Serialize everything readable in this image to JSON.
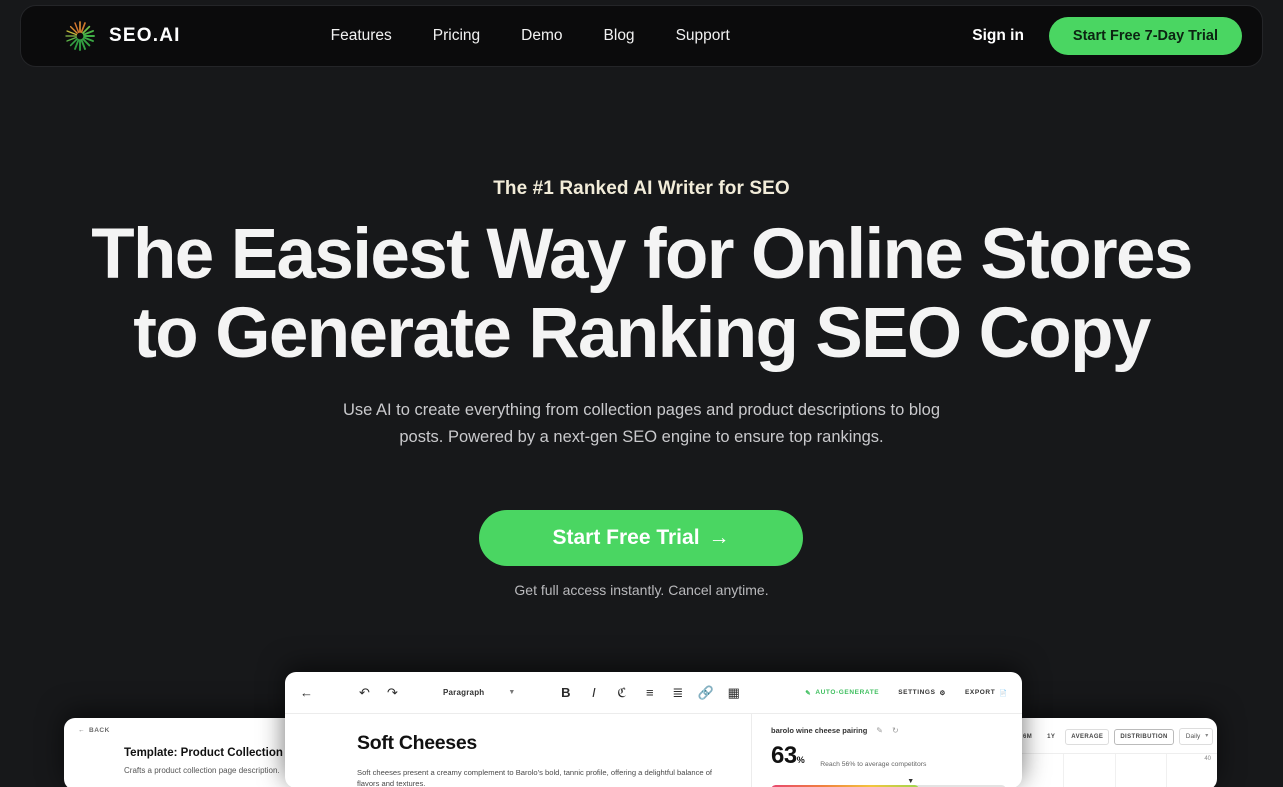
{
  "brand": {
    "name": "SEO.AI",
    "logo_icon": "sunburst-logo-icon"
  },
  "nav": {
    "links": [
      {
        "label": "Features"
      },
      {
        "label": "Pricing"
      },
      {
        "label": "Demo"
      },
      {
        "label": "Blog"
      },
      {
        "label": "Support"
      }
    ],
    "signin_label": "Sign in",
    "cta_label": "Start Free 7-Day Trial"
  },
  "hero": {
    "eyebrow": "The #1 Ranked AI Writer for SEO",
    "headline_line1": "The Easiest Way for Online Stores",
    "headline_line2": "to Generate Ranking SEO Copy",
    "subtitle_line1": "Use AI to create everything from collection pages and product descriptions to blog",
    "subtitle_line2": "posts. Powered by a next-gen SEO engine to ensure top rankings.",
    "cta_label": "Start Free Trial",
    "cta_arrow": "→",
    "cta_subtext": "Get full access instantly. Cancel anytime."
  },
  "preview": {
    "left_panel": {
      "back_label": "BACK",
      "back_icon": "arrow-left-icon",
      "title": "Template: Product Collection Desc",
      "description": "Crafts a product collection page description."
    },
    "editor": {
      "toolbar": {
        "back_icon": "arrow-left-icon",
        "undo_icon": "undo-icon",
        "redo_icon": "redo-icon",
        "block_style": "Paragraph",
        "chevron_icon": "chevron-down-icon",
        "bold_icon": "bold-icon",
        "italic_icon": "italic-icon",
        "highlight_icon": "highlight-icon",
        "bullet_list_icon": "bullet-list-icon",
        "numbered_list_icon": "numbered-list-icon",
        "link_icon": "link-icon",
        "table_icon": "table-icon",
        "auto_generate_label": "AUTO-GENERATE",
        "auto_generate_icon": "pencil-icon",
        "settings_label": "SETTINGS",
        "settings_icon": "gear-icon",
        "export_label": "EXPORT",
        "export_icon": "document-icon"
      },
      "document": {
        "heading": "Soft Cheeses",
        "paragraph": "Soft cheeses present a creamy complement to Barolo's bold, tannic profile, offering a delightful balance of flavors and textures."
      },
      "score_panel": {
        "keyword": "barolo wine cheese pairing",
        "edit_icon": "pencil-icon",
        "refresh_icon": "refresh-icon",
        "score": "63",
        "score_unit": "%",
        "note": "Reach 56% to average competitors",
        "marker_icon": "triangle-down-icon"
      }
    },
    "right_panel": {
      "tabs": [
        {
          "label": "6M"
        },
        {
          "label": "1Y"
        },
        {
          "label": "AVERAGE"
        },
        {
          "label": "DISTRIBUTION"
        }
      ],
      "interval": "Daily",
      "chart_axis_label": "40"
    }
  },
  "colors": {
    "page_background": "#17181a",
    "navbar_background": "#0b0b0c",
    "accent_green": "#4ad662",
    "eyebrow_cream": "#f2ecd9",
    "headline_white": "#f4f4f4"
  }
}
